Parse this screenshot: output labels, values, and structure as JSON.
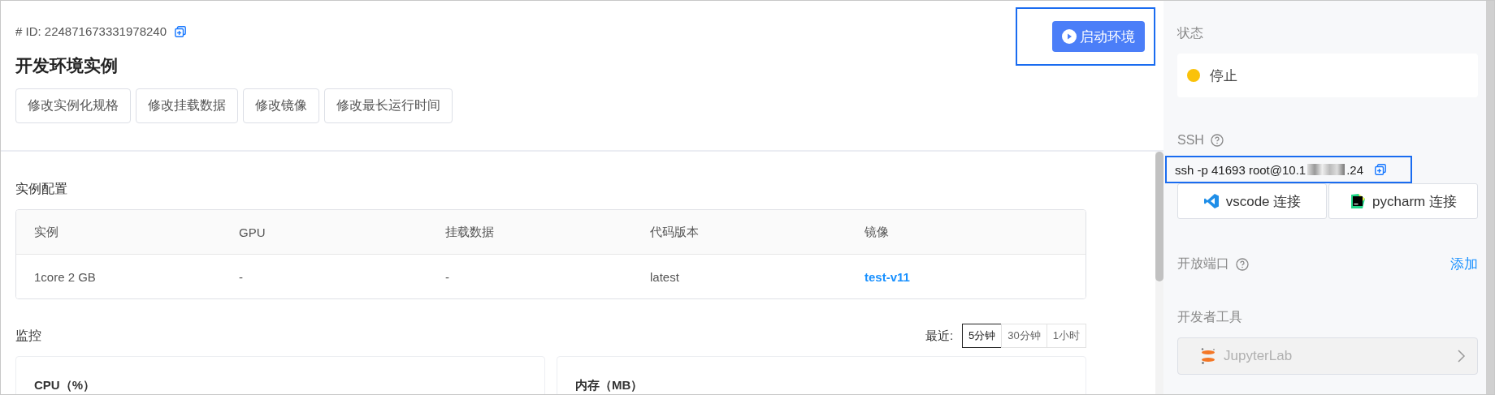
{
  "header": {
    "id_label": "# ID: 224871673331978240",
    "title": "开发环境实例",
    "actions": [
      "修改实例化规格",
      "修改挂载数据",
      "修改镜像",
      "修改最长运行时间"
    ],
    "launch_button": "启动环境"
  },
  "config": {
    "title": "实例配置",
    "columns": [
      "实例",
      "GPU",
      "挂载数据",
      "代码版本",
      "镜像"
    ],
    "rows": [
      [
        {
          "text": "1core 2 GB",
          "kind": "text"
        },
        {
          "text": "-",
          "kind": "text"
        },
        {
          "text": "-",
          "kind": "text"
        },
        {
          "text": "latest",
          "kind": "text"
        },
        {
          "text": "test-v11",
          "kind": "link"
        }
      ]
    ]
  },
  "monitoring": {
    "title": "监控",
    "range_label": "最近:",
    "ranges": [
      {
        "label": "5分钟",
        "selected": true
      },
      {
        "label": "30分钟",
        "selected": false
      },
      {
        "label": "1小时",
        "selected": false
      }
    ],
    "charts": [
      {
        "title": "CPU（%）"
      },
      {
        "title": "内存（MB）"
      }
    ]
  },
  "sidebar": {
    "status_title": "状态",
    "status": "停止",
    "ssh_title": "SSH",
    "ssh_command": "ssh -p 41693 root@10.1",
    "ssh_command_end": ".24",
    "connect_buttons": [
      {
        "label": "vscode 连接",
        "kind": "vscode"
      },
      {
        "label": "pycharm 连接",
        "kind": "pycharm"
      }
    ],
    "ports_title": "开放端口",
    "ports_action": "添加",
    "tools_title": "开发者工具",
    "tools": [
      {
        "label": "JupyterLab",
        "disabled": true
      }
    ]
  }
}
